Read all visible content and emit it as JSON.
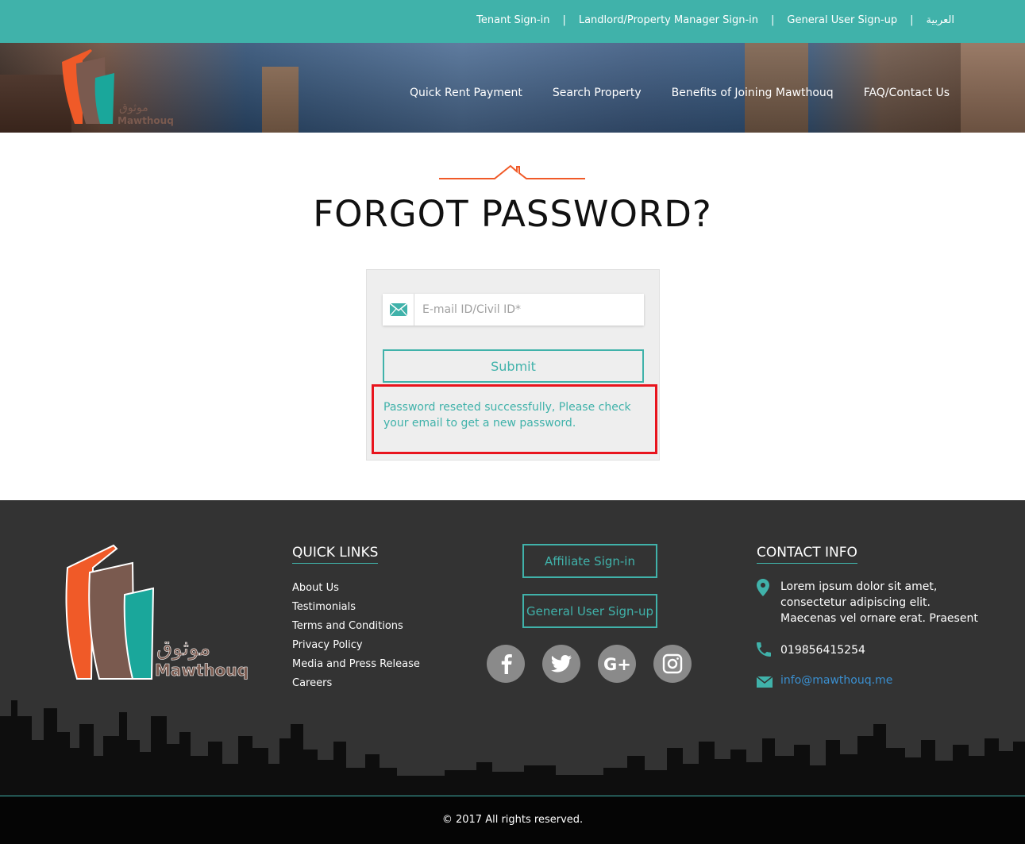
{
  "topbar": {
    "links": [
      "Tenant Sign-in",
      "Landlord/Property Manager Sign-in",
      "General User Sign-up",
      "العربية"
    ]
  },
  "nav": {
    "items": [
      "Quick Rent Payment",
      "Search Property",
      "Benefits of Joining Mawthouq",
      "FAQ/Contact Us"
    ]
  },
  "logo": {
    "arabic": "موثوق",
    "latin": "Mawthouq"
  },
  "page": {
    "title": "FORGOT PASSWORD?"
  },
  "form": {
    "email_placeholder": "E-mail ID/Civil ID*",
    "submit_label": "Submit",
    "message": "Password reseted successfully, Please check your email to get a new password."
  },
  "footer": {
    "quick_links_title": "QUICK LINKS",
    "quick_links": [
      "About Us",
      "Testimonials",
      "Terms and Conditions",
      "Privacy Policy",
      "Media and Press Release",
      "Careers"
    ],
    "affiliate_label": "Affiliate Sign-in",
    "general_signup_label": "General User Sign-up",
    "social": [
      "facebook-icon",
      "twitter-icon",
      "google-plus-icon",
      "instagram-icon"
    ],
    "contact_title": "CONTACT INFO",
    "address_lines": [
      "Lorem ipsum dolor sit amet,",
      "consectetur adipiscing elit.",
      "Maecenas vel ornare erat. Praesent"
    ],
    "phone": "019856415254",
    "email": "info@mawthouq.me",
    "copyright": "© 2017 All rights reserved."
  },
  "colors": {
    "teal": "#40b2aa",
    "orange": "#f05a28",
    "brown": "#7a5a4f",
    "highlight": "#e8141d",
    "footer_bg": "#333333"
  }
}
